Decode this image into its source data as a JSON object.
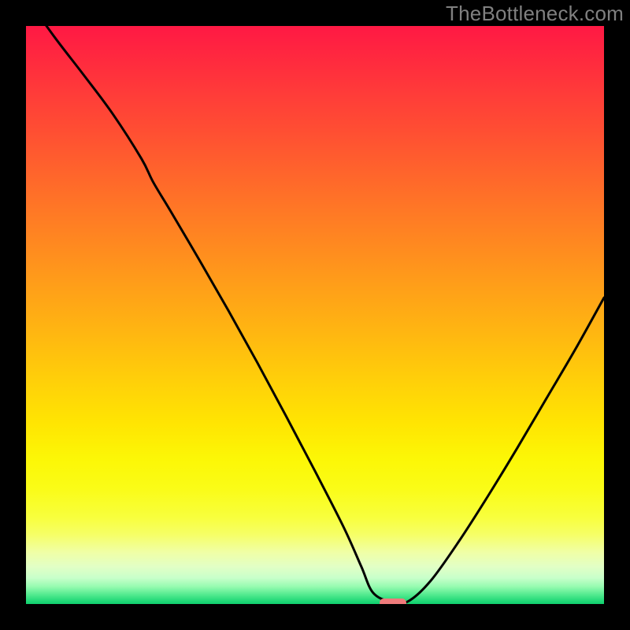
{
  "watermark": "TheBottleneck.com",
  "chart_data": {
    "type": "line",
    "title": "",
    "xlabel": "",
    "ylabel": "",
    "xlim": [
      0,
      100
    ],
    "ylim": [
      0,
      100
    ],
    "grid": false,
    "background_gradient_stops": [
      {
        "offset": 0.0,
        "color": "#ff1944"
      },
      {
        "offset": 0.0625,
        "color": "#ff2b3e"
      },
      {
        "offset": 0.125,
        "color": "#ff3e38"
      },
      {
        "offset": 0.1875,
        "color": "#ff5032"
      },
      {
        "offset": 0.25,
        "color": "#ff632c"
      },
      {
        "offset": 0.3125,
        "color": "#ff7626"
      },
      {
        "offset": 0.375,
        "color": "#ff8820"
      },
      {
        "offset": 0.4375,
        "color": "#ff9b1a"
      },
      {
        "offset": 0.5,
        "color": "#ffad14"
      },
      {
        "offset": 0.5625,
        "color": "#ffc00e"
      },
      {
        "offset": 0.625,
        "color": "#ffd308"
      },
      {
        "offset": 0.6875,
        "color": "#ffe502"
      },
      {
        "offset": 0.75,
        "color": "#fcf706"
      },
      {
        "offset": 0.8,
        "color": "#fafc17"
      },
      {
        "offset": 0.85,
        "color": "#f8ff3d"
      },
      {
        "offset": 0.88,
        "color": "#f6ff67"
      },
      {
        "offset": 0.91,
        "color": "#f0ffa5"
      },
      {
        "offset": 0.935,
        "color": "#e2ffc5"
      },
      {
        "offset": 0.955,
        "color": "#c8ffca"
      },
      {
        "offset": 0.97,
        "color": "#96fbb0"
      },
      {
        "offset": 0.983,
        "color": "#57eb91"
      },
      {
        "offset": 0.995,
        "color": "#20d876"
      },
      {
        "offset": 1.0,
        "color": "#10d06e"
      }
    ],
    "series": [
      {
        "name": "bottleneck-curve",
        "color": "#000000",
        "stroke_width": 3,
        "x": [
          0.0,
          5.0,
          10.0,
          15.0,
          20.0,
          22.0,
          25.0,
          30.0,
          35.0,
          40.0,
          45.0,
          50.0,
          55.0,
          58.0,
          60.0,
          63.0,
          66.0,
          70.0,
          75.0,
          80.0,
          85.0,
          90.0,
          95.0,
          100.0
        ],
        "values": [
          105.0,
          98.0,
          91.5,
          84.8,
          77.0,
          73.0,
          68.0,
          59.5,
          50.8,
          41.8,
          32.5,
          23.0,
          13.2,
          6.5,
          2.0,
          0.4,
          0.4,
          4.0,
          11.0,
          18.8,
          27.0,
          35.5,
          44.0,
          53.0
        ]
      }
    ],
    "marker": {
      "name": "optimal-point",
      "x": 63.5,
      "y": 0.2,
      "width_pct": 4.6,
      "height_pct": 1.4,
      "color": "#ef7b7b"
    }
  }
}
